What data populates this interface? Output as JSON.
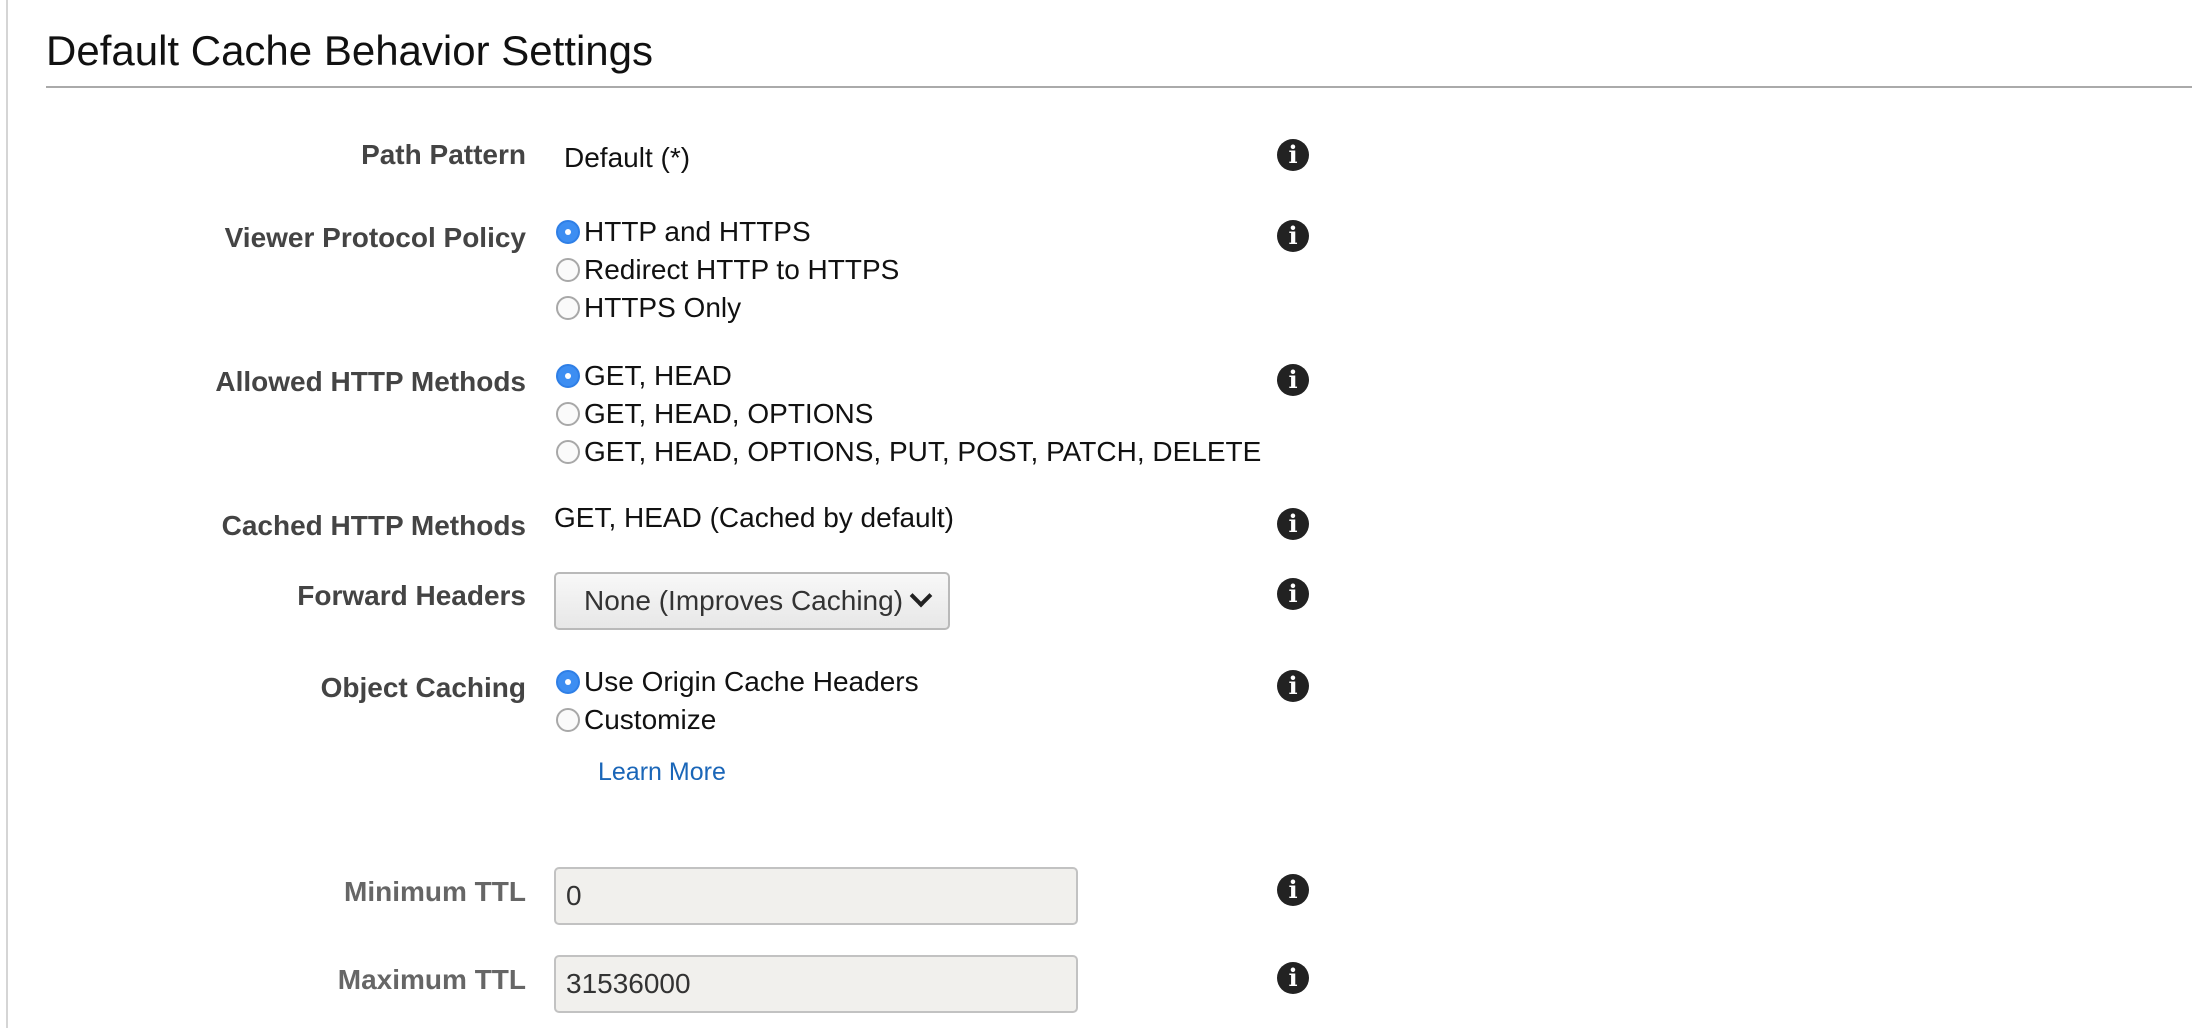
{
  "section": {
    "title": "Default Cache Behavior Settings"
  },
  "fields": {
    "path_pattern": {
      "label": "Path Pattern",
      "value": "Default (*)"
    },
    "viewer_protocol_policy": {
      "label": "Viewer Protocol Policy",
      "options": [
        "HTTP and HTTPS",
        "Redirect HTTP to HTTPS",
        "HTTPS Only"
      ],
      "selected": "HTTP and HTTPS"
    },
    "allowed_http_methods": {
      "label": "Allowed HTTP Methods",
      "options": [
        "GET, HEAD",
        "GET, HEAD, OPTIONS",
        "GET, HEAD, OPTIONS, PUT, POST, PATCH, DELETE"
      ],
      "selected": "GET, HEAD"
    },
    "cached_http_methods": {
      "label": "Cached HTTP Methods",
      "value": "GET, HEAD (Cached by default)"
    },
    "forward_headers": {
      "label": "Forward Headers",
      "selected": "None (Improves Caching)"
    },
    "object_caching": {
      "label": "Object Caching",
      "options": [
        "Use Origin Cache Headers",
        "Customize"
      ],
      "selected": "Use Origin Cache Headers",
      "learn_more": "Learn More"
    },
    "minimum_ttl": {
      "label": "Minimum TTL",
      "value": "0"
    },
    "maximum_ttl": {
      "label": "Maximum TTL",
      "value": "31536000"
    }
  },
  "icons": {
    "info": "info-icon",
    "dropdown": "chevron-down-icon"
  },
  "colors": {
    "radio_selected": "#3d8ef2",
    "link": "#1a66b8",
    "label": "#444444",
    "input_background": "#f1f0ed"
  }
}
